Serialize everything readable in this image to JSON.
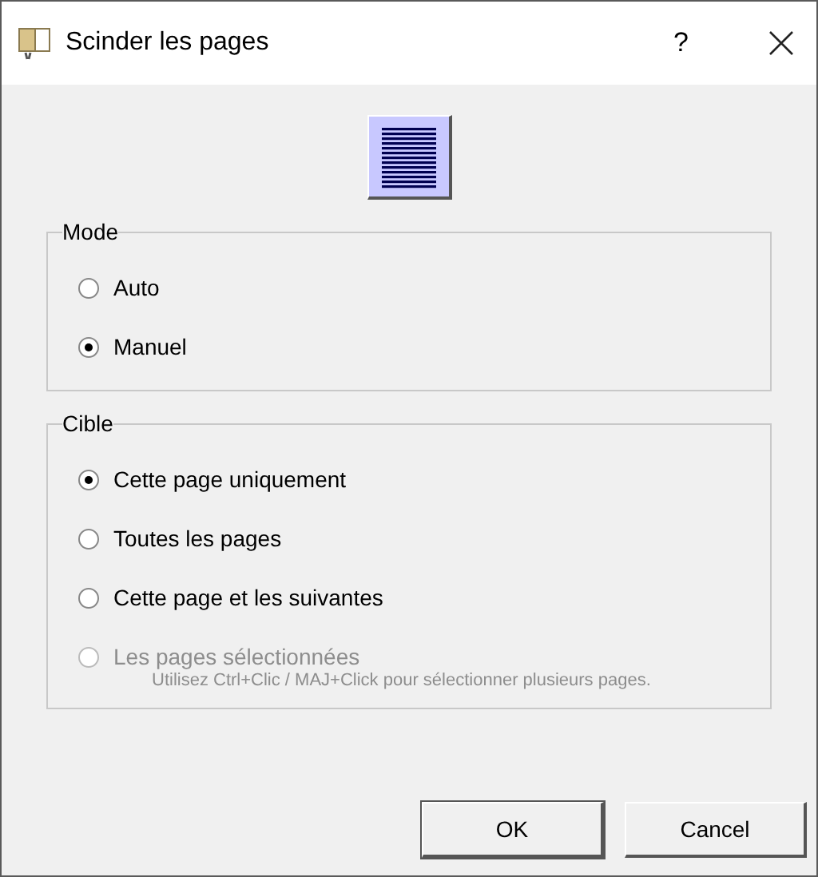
{
  "window": {
    "title": "Scinder les pages",
    "help": "?"
  },
  "groups": [
    {
      "title": "Mode",
      "options": [
        {
          "label": "Auto",
          "selected": false,
          "disabled": false
        },
        {
          "label": "Manuel",
          "selected": true,
          "disabled": false
        }
      ]
    },
    {
      "title": "Cible",
      "options": [
        {
          "label": "Cette page uniquement",
          "selected": true,
          "disabled": false
        },
        {
          "label": "Toutes les pages",
          "selected": false,
          "disabled": false
        },
        {
          "label": "Cette page et les suivantes",
          "selected": false,
          "disabled": false
        },
        {
          "label": "Les pages sélectionnées",
          "selected": false,
          "disabled": true,
          "hint": "Utilisez Ctrl+Clic / MAJ+Click pour sélectionner plusieurs pages."
        }
      ]
    }
  ],
  "buttons": [
    "OK",
    "Cancel"
  ]
}
